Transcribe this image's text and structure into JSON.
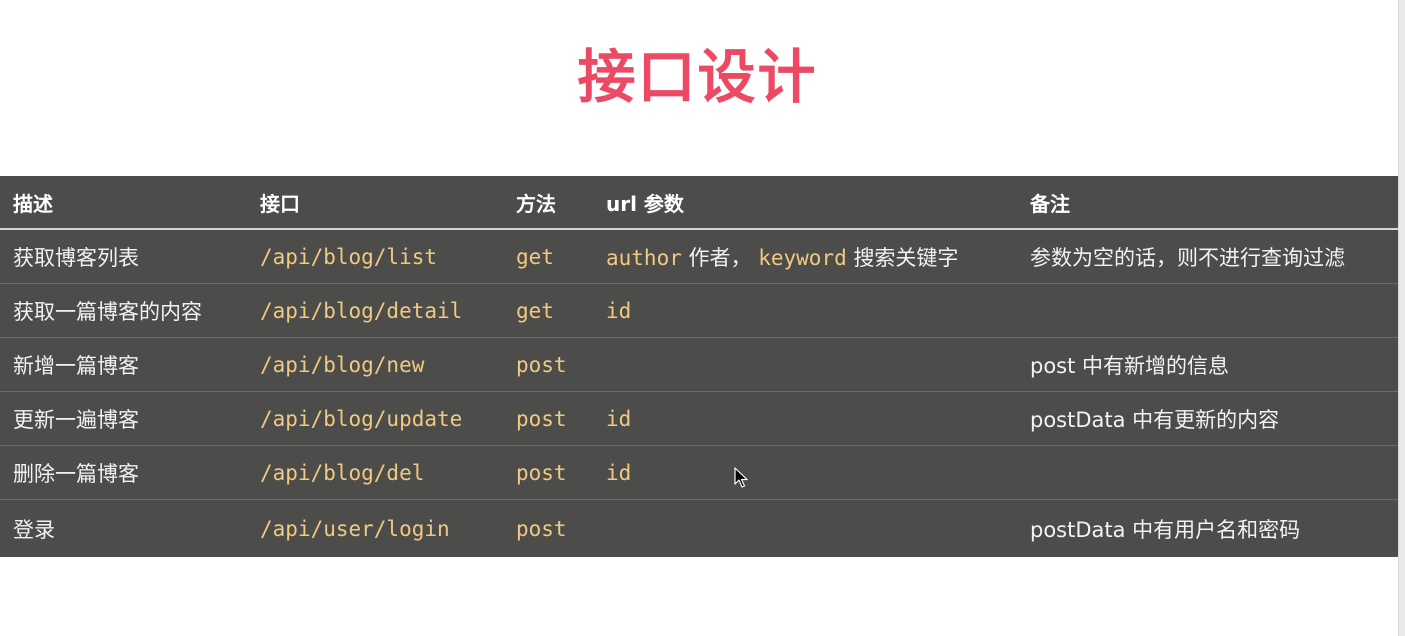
{
  "title": "接口设计",
  "table": {
    "headers": [
      "描述",
      "接口",
      "方法",
      "url 参数",
      "备注"
    ],
    "rows": [
      {
        "desc": "获取博客列表",
        "api": "/api/blog/list",
        "method": "get",
        "params": [
          {
            "code": "author",
            "text": "作者，"
          },
          {
            "code": "keyword",
            "text": "搜索关键字"
          }
        ],
        "note": "参数为空的话，则不进行查询过滤"
      },
      {
        "desc": "获取一篇博客的内容",
        "api": "/api/blog/detail",
        "method": "get",
        "params": [
          {
            "code": "id",
            "text": ""
          }
        ],
        "note": ""
      },
      {
        "desc": "新增一篇博客",
        "api": "/api/blog/new",
        "method": "post",
        "params": [],
        "note": "post 中有新增的信息"
      },
      {
        "desc": "更新一遍博客",
        "api": "/api/blog/update",
        "method": "post",
        "params": [
          {
            "code": "id",
            "text": ""
          }
        ],
        "note": "postData 中有更新的内容"
      },
      {
        "desc": "删除一篇博客",
        "api": "/api/blog/del",
        "method": "post",
        "params": [
          {
            "code": "id",
            "text": ""
          }
        ],
        "note": ""
      },
      {
        "desc": "登录",
        "api": "/api/user/login",
        "method": "post",
        "params": [],
        "note": "postData 中有用户名和密码"
      }
    ]
  },
  "colors": {
    "title": "#ec4a64",
    "table_bg": "#4c4d4a",
    "code": "#f1c981",
    "text": "#f2f2f2"
  },
  "icons": [
    "mouse-cursor-icon"
  ]
}
